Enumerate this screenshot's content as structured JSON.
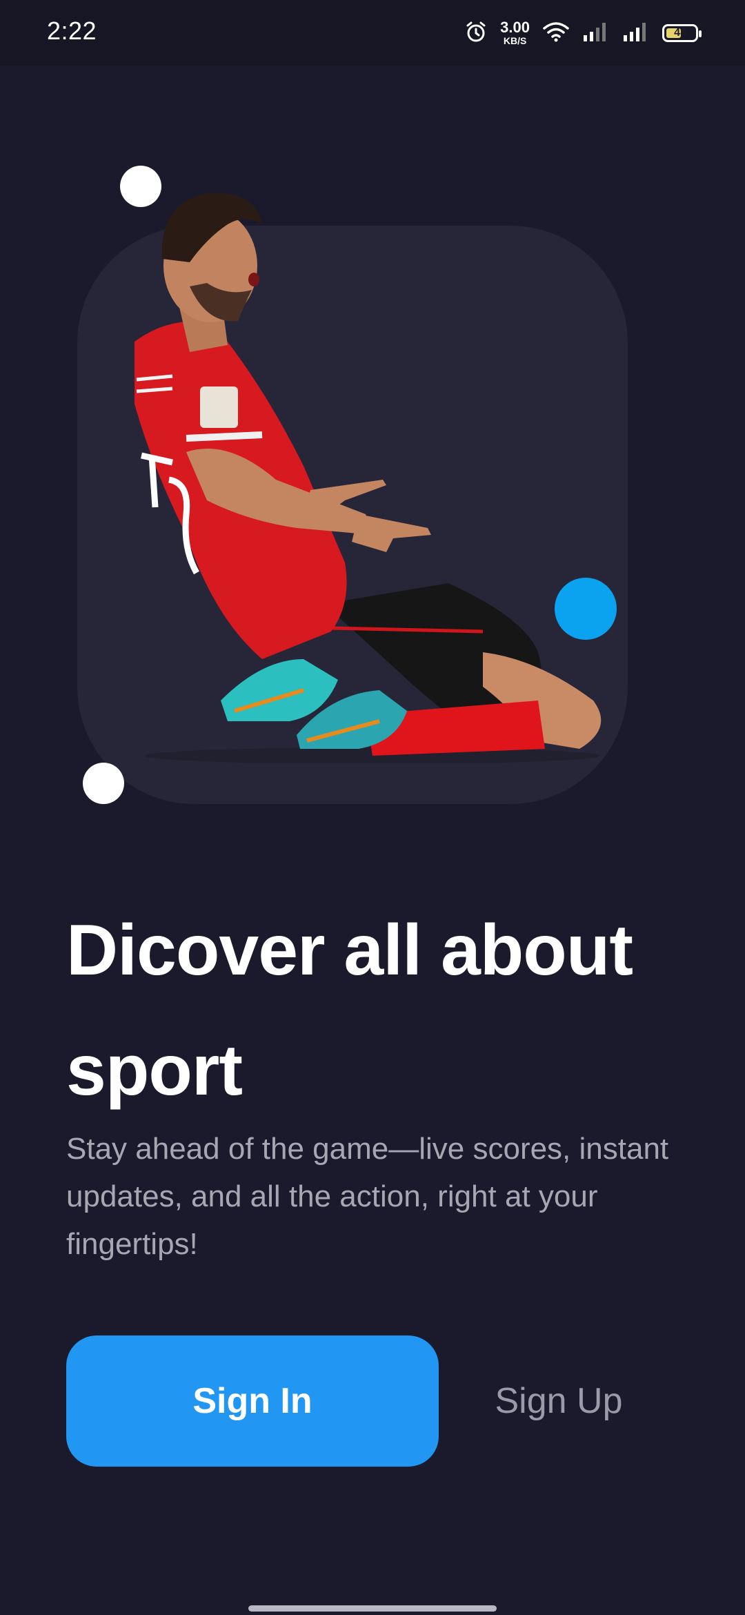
{
  "status_bar": {
    "time": "2:22",
    "network_speed_value": "3.00",
    "network_speed_unit": "KB/S",
    "battery_level": "48",
    "icons": [
      "alarm-icon",
      "wifi-icon",
      "signal-icon",
      "signal-icon",
      "battery-icon"
    ]
  },
  "hero": {
    "image": "footballer-celebrating-kneeling",
    "accent_colors": {
      "card": "#262638",
      "dot_white": "#ffffff",
      "dot_blue": "#0ba2f0"
    }
  },
  "onboarding": {
    "title": "Dicover all about sport",
    "subtitle": "Stay ahead of the game—live scores, instant updates, and all the action, right at your fingertips!"
  },
  "actions": {
    "sign_in_label": "Sign In",
    "sign_up_label": "Sign Up",
    "primary_color": "#2196f3"
  }
}
